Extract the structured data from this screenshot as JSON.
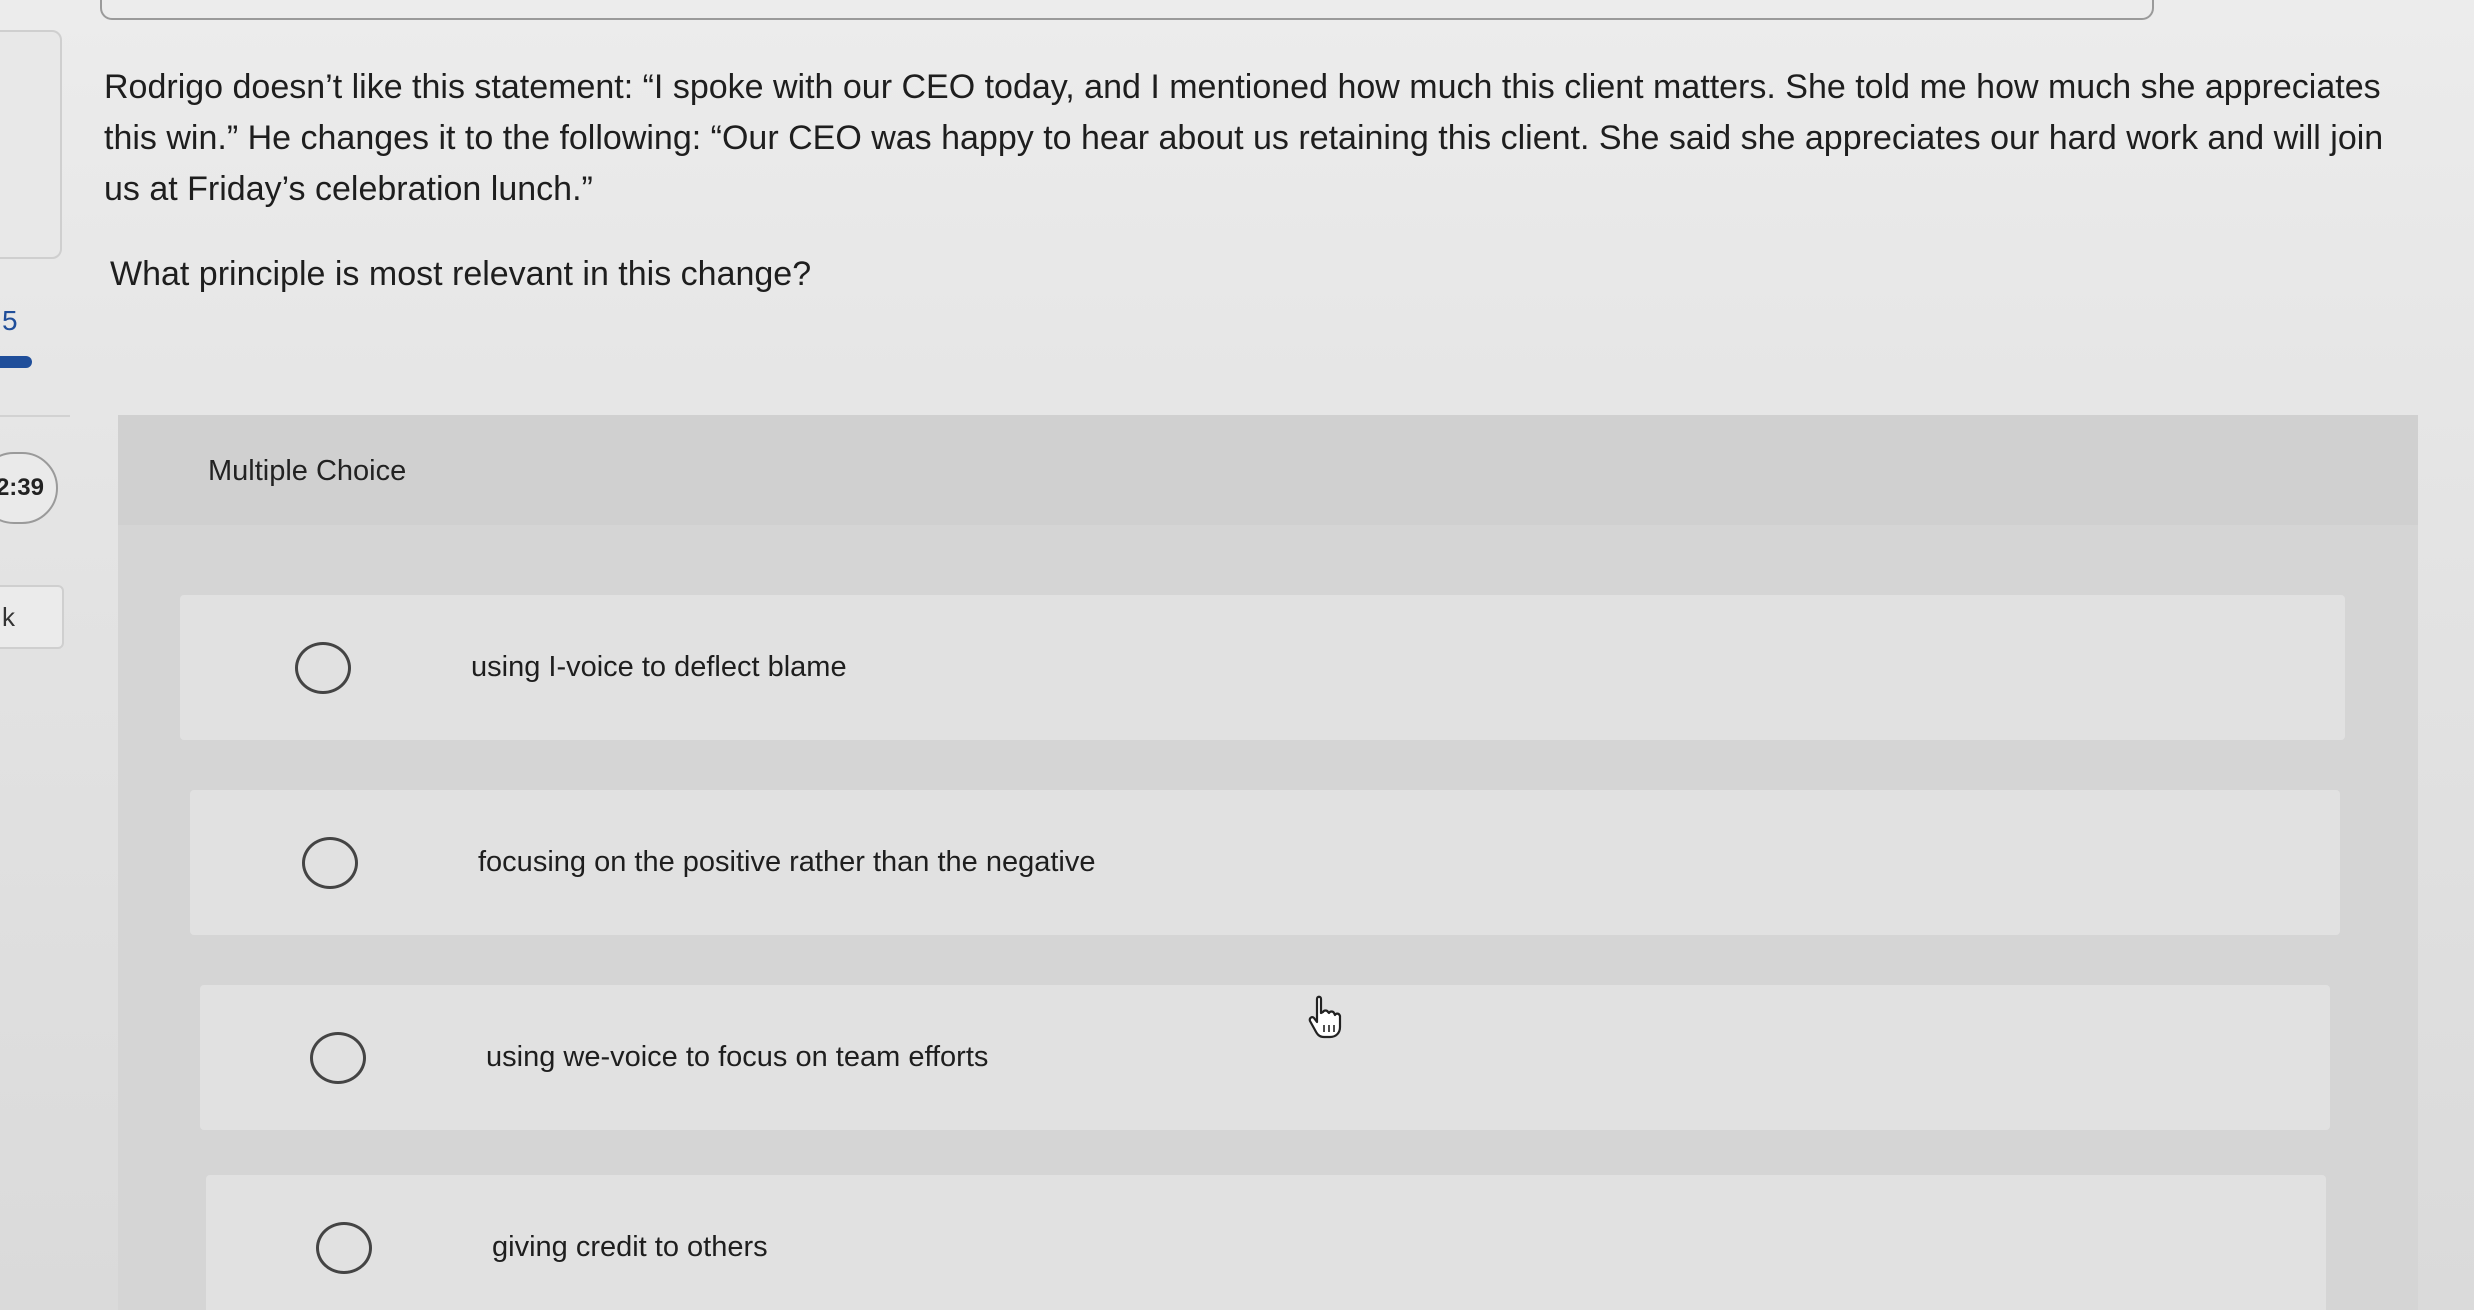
{
  "sidebar": {
    "question_number": "5",
    "timer": "2:39",
    "button_partial": "k"
  },
  "question": {
    "text": "Rodrigo doesn’t like this statement: “I spoke with our CEO today, and I mentioned how much this client matters. She told me how much she appreciates this win.” He changes it to the following: “Our CEO was happy to hear about us retaining this client. She said she appreciates our hard work and will join us at Friday’s celebration lunch.”",
    "prompt": "What principle is most relevant in this change?"
  },
  "multiple_choice": {
    "label": "Multiple Choice",
    "options": [
      {
        "text": "using I-voice to deflect blame"
      },
      {
        "text": "focusing on the positive rather than the negative"
      },
      {
        "text": "using we-voice to focus on team efforts"
      },
      {
        "text": "giving credit to others"
      }
    ]
  },
  "colors": {
    "accent": "#1f4e9a",
    "panel": "#d5d5d5",
    "option_bg": "#e1e1e1"
  },
  "icons": {
    "cursor": "hand-pointer-icon"
  }
}
